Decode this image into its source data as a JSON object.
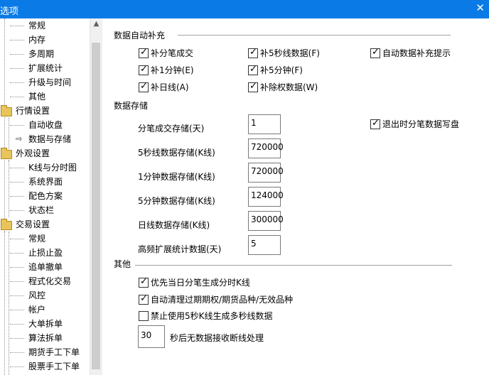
{
  "window": {
    "title": "选项",
    "close_glyph": "✕"
  },
  "tree": {
    "items": [
      {
        "label": "常规",
        "level": 2
      },
      {
        "label": "内存",
        "level": 2
      },
      {
        "label": "多周期",
        "level": 2
      },
      {
        "label": "扩展统计",
        "level": 2
      },
      {
        "label": "升级与时间",
        "level": 2
      },
      {
        "label": "其他",
        "level": 2
      },
      {
        "label": "行情设置",
        "level": 1
      },
      {
        "label": "自动收盘",
        "level": 2
      },
      {
        "label": "数据与存储",
        "level": 2,
        "selected": true
      },
      {
        "label": "外观设置",
        "level": 1
      },
      {
        "label": "K线与分时图",
        "level": 2
      },
      {
        "label": "系统界面",
        "level": 2
      },
      {
        "label": "配色方案",
        "level": 2
      },
      {
        "label": "状态栏",
        "level": 2
      },
      {
        "label": "交易设置",
        "level": 1
      },
      {
        "label": "常规",
        "level": 2
      },
      {
        "label": "止损止盈",
        "level": 2
      },
      {
        "label": "追单撤单",
        "level": 2
      },
      {
        "label": "程式化交易",
        "level": 2
      },
      {
        "label": "风控",
        "level": 2
      },
      {
        "label": "帐户",
        "level": 2
      },
      {
        "label": "大单拆单",
        "level": 2
      },
      {
        "label": "算法拆单",
        "level": 2
      },
      {
        "label": "期货手工下单",
        "level": 2
      },
      {
        "label": "股票手工下单",
        "level": 2
      }
    ]
  },
  "sections": {
    "autofill": {
      "title": "数据自动补充",
      "checkboxes": [
        {
          "label": "补分笔成交",
          "checked": true
        },
        {
          "label": "补5秒线数据(F)",
          "checked": true
        },
        {
          "label": "自动数据补充提示",
          "checked": true
        },
        {
          "label": "补1分钟(E)",
          "checked": true
        },
        {
          "label": "补5分钟(F)",
          "checked": true
        },
        {
          "label": "补日线(A)",
          "checked": true
        },
        {
          "label": "补除权数据(W)",
          "checked": true
        }
      ]
    },
    "storage": {
      "title": "数据存储",
      "fields": [
        {
          "label": "分笔成交存储(天)",
          "value": "1"
        },
        {
          "label": "5秒线数据存储(K线)",
          "value": "720000"
        },
        {
          "label": "1分钟数据存储(K线)",
          "value": "720000"
        },
        {
          "label": "5分钟数据存储(K线)",
          "value": "124000"
        },
        {
          "label": "日线数据存储(K线)",
          "value": "300000"
        },
        {
          "label": "高频扩展统计数据(天)",
          "value": "5"
        }
      ],
      "exit_checkbox": {
        "label": "退出时分笔数据写盘",
        "checked": true
      }
    },
    "other": {
      "title": "其他",
      "checkboxes": [
        {
          "label": "优先当日分笔生成分时K线",
          "checked": true
        },
        {
          "label": "自动清理过期期权/期货品种/无效品种",
          "checked": true
        },
        {
          "label": "禁止使用5秒K线生成多秒线数据",
          "checked": false
        }
      ],
      "timeout_value": "30",
      "timeout_label": "秒后无数据接收断线处理"
    }
  },
  "tick_glyph": "✓",
  "scroll_up_glyph": "▲",
  "selected_marker_glyph": "⇨"
}
